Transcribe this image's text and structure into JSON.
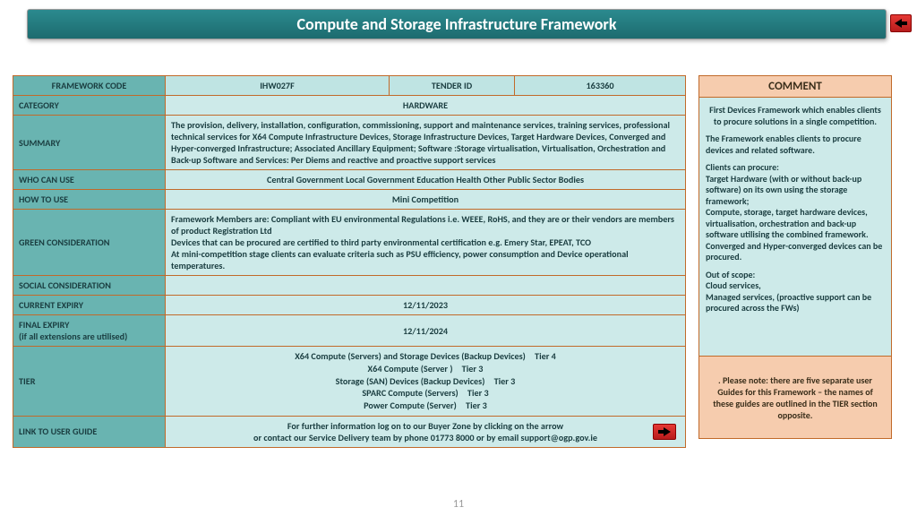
{
  "title": "Compute and Storage Infrastructure Framework",
  "page_number": "11",
  "header": {
    "framework_code_label": "FRAMEWORK CODE",
    "framework_code_value": "IHW027F",
    "tender_id_label": "TENDER ID",
    "tender_id_value": "163360"
  },
  "rows": {
    "category_label": "CATEGORY",
    "category_value": "HARDWARE",
    "summary_label": "SUMMARY",
    "summary_value": "The provision, delivery, installation, configuration, commissioning, support and maintenance services, training services, professional technical services for X64 Compute Infrastructure Devices, Storage Infrastructure Devices, Target Hardware Devices, Converged and Hyper-converged Infrastructure; Associated Ancillary Equipment; Software :Storage virtualisation, Virtualisation, Orchestration and Back-up Software and Services: Per Diems and reactive and proactive support services",
    "who_label": "WHO CAN USE",
    "who_value": "Central Government Local Government Education Health Other Public Sector Bodies",
    "how_label": "HOW TO USE",
    "how_value": "Mini Competition",
    "green_label": "GREEN CONSIDERATION",
    "green_value": "Framework Members are: Compliant with EU environmental Regulations i.e. WEEE, RoHS, and they are or their vendors are members of product Registration Ltd\nDevices that can be procured are certified to third party environmental certification e.g. Emery Star, EPEAT, TCO\nAt mini-competition stage clients can evaluate criteria such as PSU efficiency, power consumption and Device operational temperatures.",
    "social_label": "SOCIAL CONSIDERATION",
    "social_value": "",
    "expiry_label": "CURRENT EXPIRY",
    "expiry_value": "12/11/2023",
    "final_label": "FINAL EXPIRY\n(if all extensions are utilised)",
    "final_value": "12/11/2024",
    "tier_label": "TIER",
    "tier_l1": "X64 Compute (Servers) and Storage Devices (Backup Devices) Tier 4",
    "tier_l2": "X64 Compute (Server ) Tier 3",
    "tier_l3": "Storage (SAN) Devices (Backup Devices) Tier 3",
    "tier_l4": "SPARC Compute (Servers) Tier 3",
    "tier_l5": "Power Compute (Server) Tier 3",
    "link_label": "LINK TO USER GUIDE",
    "link_l1": "For further information log on to our Buyer Zone by clicking on the arrow",
    "link_l2": "or contact our Service Delivery team by phone  01773 8000 or by email  support@ogp.gov.ie"
  },
  "comment": {
    "heading": "COMMENT",
    "p1": "First Devices Framework which enables clients to procure solutions in a single competition.",
    "p2": "The Framework enables clients to procure devices and related software.",
    "p3": "Clients can procure:\nTarget Hardware (with or without back-up software) on its own using the storage framework;\nCompute, storage, target hardware devices, virtualisation, orchestration and back-up software utilising the combined framework.\nConverged and Hyper-converged devices can be procured.",
    "p4": "Out of scope:\nCloud services,\nManaged services, (proactive support can be procured across the FWs)",
    "note": ". Please note: there are five separate user Guides for this Framework – the names of these guides are outlined  in the TIER section opposite."
  }
}
